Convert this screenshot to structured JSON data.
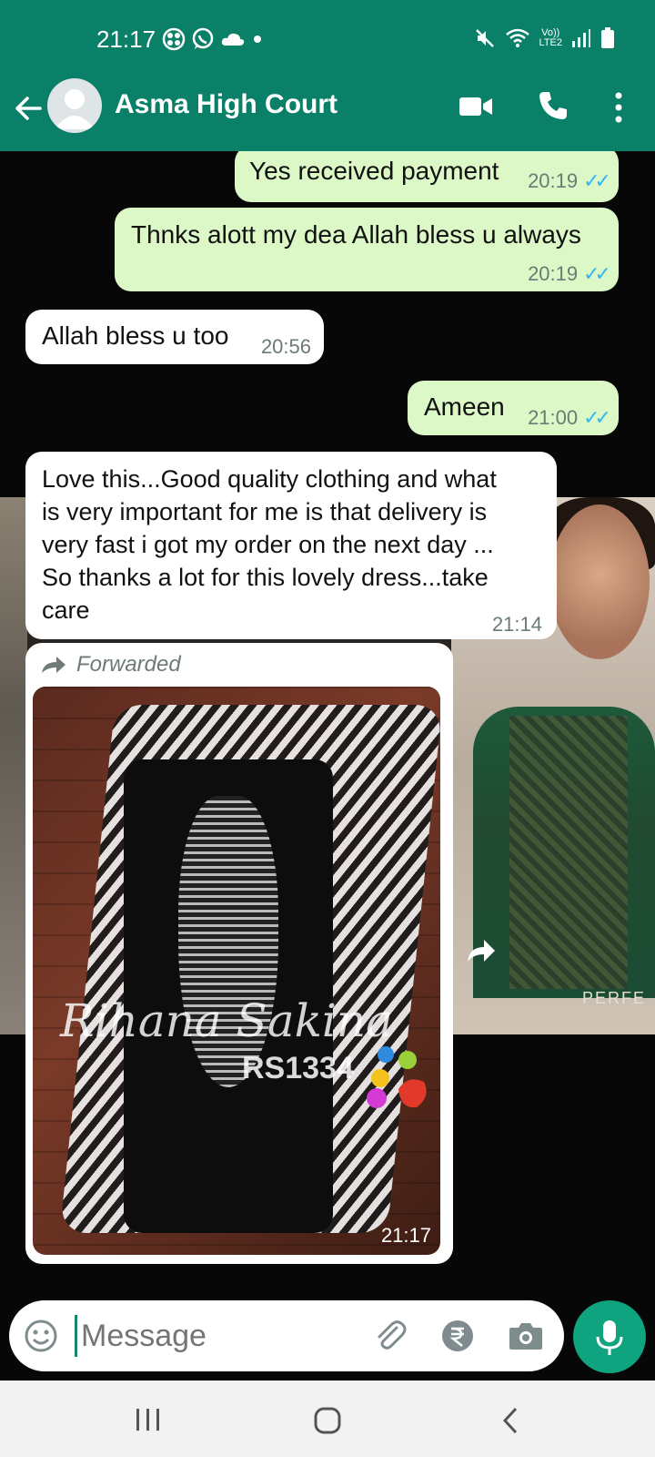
{
  "status_bar": {
    "time": "21:17",
    "left_icons": [
      "nav-app-icon",
      "whatsapp-icon",
      "cloud-icon",
      "dot-icon"
    ],
    "right_icons": [
      "mute-icon",
      "wifi-icon",
      "volte-indicator",
      "signal-icon",
      "battery-icon"
    ],
    "volte_line1": "Vo))",
    "volte_line2": "LTE2"
  },
  "header": {
    "contact_name": "Asma High Court",
    "icons": [
      "back-arrow-icon",
      "avatar",
      "video-call-icon",
      "phone-icon",
      "more-vert-icon"
    ]
  },
  "messages": [
    {
      "direction": "out",
      "text": "Yes received payment",
      "time": "20:19",
      "status": "read"
    },
    {
      "direction": "out",
      "text": "Thnks alott my dea Allah bless u always",
      "time": "20:19",
      "status": "read"
    },
    {
      "direction": "in",
      "text": "Allah bless u too",
      "time": "20:56"
    },
    {
      "direction": "out",
      "text": "Ameen",
      "time": "21:00",
      "status": "read"
    },
    {
      "direction": "in",
      "text_lines": [
        "Love this...Good quality clothing and what",
        "is very important for me is that delivery is",
        "very fast i got my order on the next day ...",
        "So thanks a lot for this lovely dress...take",
        "care"
      ],
      "time": "21:14"
    },
    {
      "direction": "in",
      "type": "image",
      "forwarded_label": "Forwarded",
      "image_text_brand": "Rihana Sakina",
      "image_text_code": "RS1334",
      "time": "21:17"
    }
  ],
  "background_text": "PERFE",
  "composer": {
    "placeholder": "Message",
    "icons": [
      "emoji-icon",
      "attach-icon",
      "rupee-icon",
      "camera-icon",
      "mic-icon"
    ]
  },
  "colors": {
    "header": "#0b8069",
    "outgoing_bubble": "#dcf8c6",
    "incoming_bubble": "#ffffff",
    "read_ticks": "#34b7f1",
    "mic_button": "#0fa37f"
  }
}
